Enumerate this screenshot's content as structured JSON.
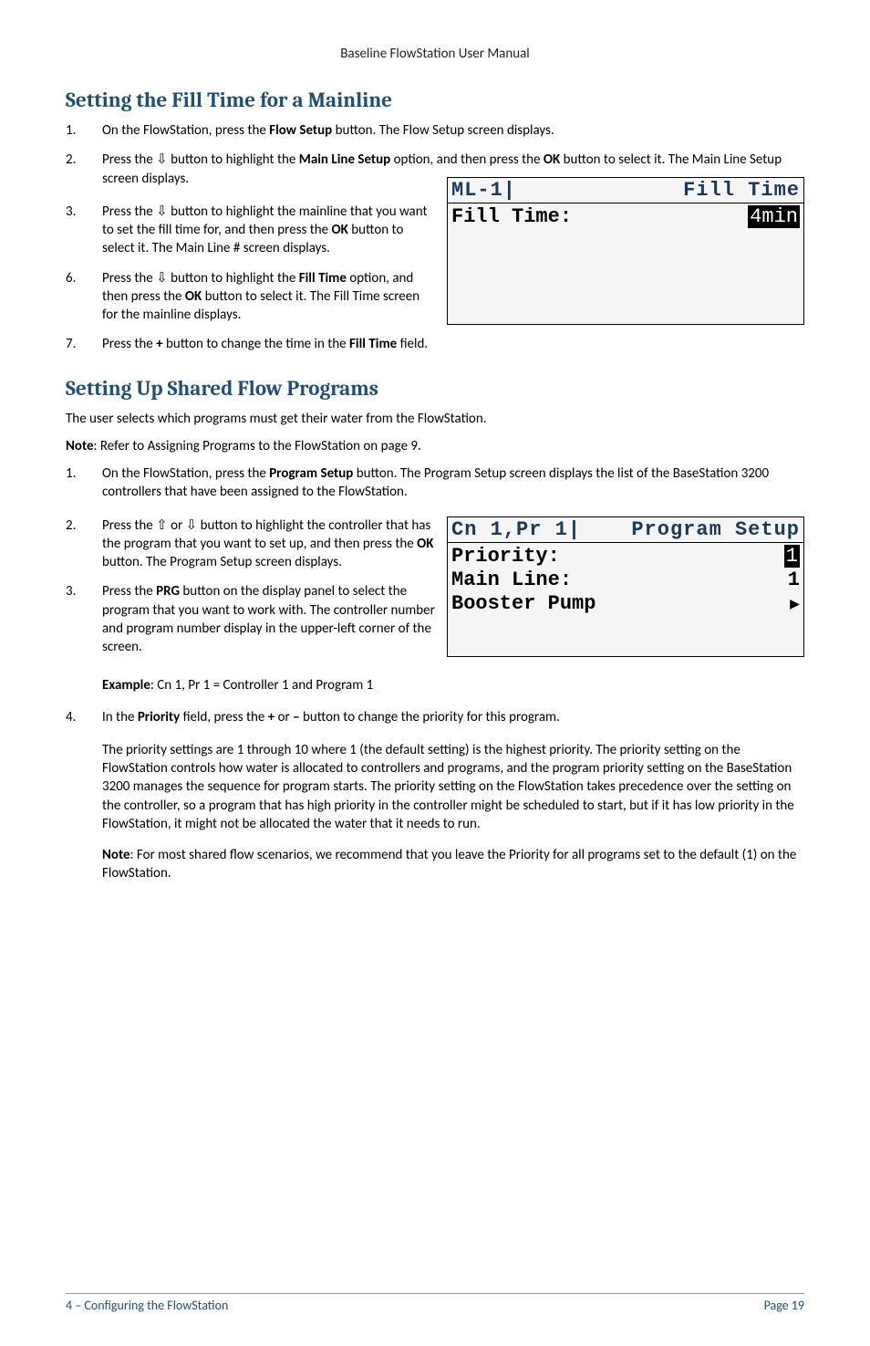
{
  "header": "Baseline FlowStation User Manual",
  "section_a": {
    "title": "Setting the Fill Time for a Mainline",
    "steps": [
      {
        "n": "1.",
        "pre": "On the FlowStation, press the ",
        "b1": "Flow Setup",
        "post": " button. The Flow Setup screen displays."
      },
      {
        "n": "2.",
        "pre": "Press the ",
        "arrow": "⇩",
        "mid": " button to highlight the ",
        "b1": "Main Line Setup",
        "mid2": " option, and then press the ",
        "b2": "OK",
        "post": " button to select it. The Main Line Setup screen displays."
      },
      {
        "n": "3.",
        "pre": "Press the ",
        "arrow": "⇩",
        "mid": " button to highlight the mainline that you want to set the fill time for, and then press the ",
        "b1": "OK",
        "post": " button to select it. The Main Line # screen displays."
      },
      {
        "n": "6.",
        "pre": "Press the ",
        "arrow": "⇩",
        "mid": " button to highlight the ",
        "b1": "Fill Time",
        "mid2": " option, and then press the ",
        "b2": "OK",
        "post": " button to select it. The Fill Time screen for the mainline displays."
      },
      {
        "n": "7.",
        "pre": "Press the ",
        "b1": "+",
        "mid": " button to change the time in the ",
        "b2": "Fill Time",
        "post": " field."
      }
    ]
  },
  "lcd_a": {
    "title_left": "ML-1|",
    "title_right": "Fill Time",
    "row1_label": "Fill Time:",
    "row1_value": "4min"
  },
  "section_b": {
    "title": "Setting Up Shared Flow Programs",
    "intro": "The user selects which programs must get their water from the FlowStation.",
    "note": "Note",
    "note_text": ": Refer to Assigning Programs to the FlowStation on page 9.",
    "steps": {
      "s1": {
        "n": "1.",
        "pre": "On the FlowStation, press the ",
        "b1": "Program Setup",
        "post": " button. The Program Setup screen displays the list of the BaseStation 3200 controllers that have been assigned to the FlowStation."
      },
      "s2": {
        "n": "2.",
        "pre": "Press the ",
        "a1": "⇧",
        "mid": " or ",
        "a2": "⇩",
        "mid2": " button to highlight the controller that has the program that you want to set up, and then press the ",
        "b1": "OK",
        "post": " button. The Program Setup screen displays."
      },
      "s3": {
        "n": "3.",
        "pre": "Press the ",
        "b1": "PRG",
        "post": " button on the display panel to select the program that you want to work with. The controller number and program number display in the upper-left corner of the screen."
      },
      "s4": {
        "n": "4.",
        "pre": "In the ",
        "b1": "Priority",
        "mid": " field, press the ",
        "b2": "+",
        "mid2": " or ",
        "b3": "–",
        "post": " button to change the priority for this program."
      }
    },
    "example_label": "Example",
    "example_text": ": Cn 1, Pr 1 = Controller 1 and Program 1",
    "para_priority": "The priority settings are 1 through 10 where 1 (the default setting) is the highest priority. The priority setting on the FlowStation controls how water is allocated to controllers and programs, and the program priority setting on the BaseStation 3200 manages the sequence for program starts. The priority setting on the FlowStation takes precedence over the setting on the controller, so a program that has high priority in the controller might be scheduled to start, but if it has low priority in the FlowStation, it might not be allocated the water that it needs to run.",
    "note2_label": "Note",
    "note2_text": ": For most shared flow scenarios, we recommend that you leave the Priority for all programs set to the default (1) on the FlowStation."
  },
  "lcd_b": {
    "title_left": "Cn 1,Pr 1|",
    "title_right": "Program Setup",
    "row1_label": "Priority:",
    "row1_value": "1",
    "row2_label": "Main Line:",
    "row2_value": "1",
    "row3_label": "Booster Pump",
    "row3_value": "▶"
  },
  "footer": {
    "left": "4 – Configuring the FlowStation",
    "right": "Page 19"
  }
}
